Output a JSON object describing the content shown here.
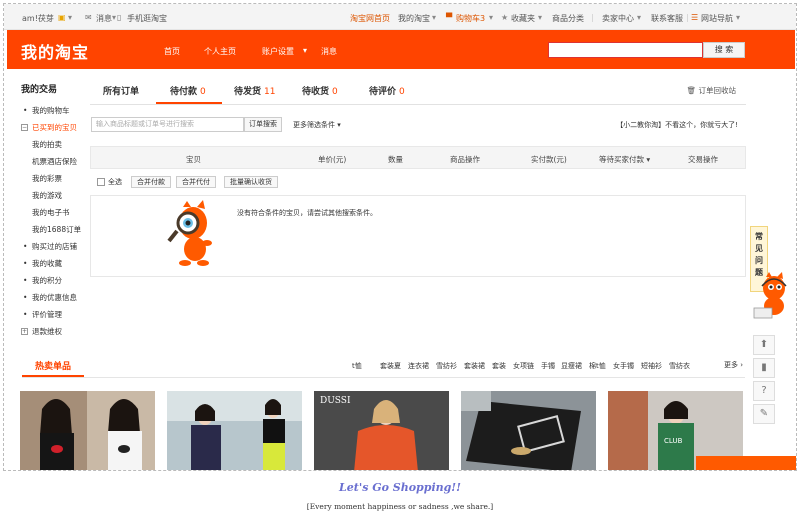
{
  "topbar": {
    "user": "am!茯芽",
    "messages": "消息",
    "mobile": "手机逛淘宝",
    "home": "淘宝网首页",
    "my_taobao": "我的淘宝",
    "cart": "购物车3",
    "favorites": "收藏夹",
    "categories": "商品分类",
    "seller": "卖家中心",
    "service": "联系客服",
    "site_nav": "网站导航"
  },
  "header": {
    "brand": "我的淘宝",
    "nav": [
      "首页",
      "个人主页",
      "账户设置",
      "消息"
    ],
    "search_button": "搜 索"
  },
  "sidebar": {
    "title": "我的交易",
    "items": [
      {
        "label": "我的购物车",
        "type": "bullet"
      },
      {
        "label": "已买到的宝贝",
        "type": "box-active"
      },
      {
        "label": "我的拍卖",
        "type": "sub"
      },
      {
        "label": "机票酒店保险",
        "type": "sub"
      },
      {
        "label": "我的彩票",
        "type": "sub"
      },
      {
        "label": "我的游戏",
        "type": "sub"
      },
      {
        "label": "我的电子书",
        "type": "sub"
      },
      {
        "label": "我的1688订单",
        "type": "sub"
      },
      {
        "label": "购买过的店铺",
        "type": "bullet"
      },
      {
        "label": "我的收藏",
        "type": "bullet"
      },
      {
        "label": "我的积分",
        "type": "bullet"
      },
      {
        "label": "我的优惠信息",
        "type": "bullet"
      },
      {
        "label": "评价管理",
        "type": "bullet"
      },
      {
        "label": "退款维权",
        "type": "box"
      }
    ]
  },
  "tabs": [
    {
      "label": "所有订单",
      "count": ""
    },
    {
      "label": "待付款",
      "count": "0"
    },
    {
      "label": "待发货",
      "count": "11"
    },
    {
      "label": "待收货",
      "count": "0"
    },
    {
      "label": "待评价",
      "count": "0"
    }
  ],
  "recycle_bin": "订单回收站",
  "filter": {
    "placeholder": "输入商品标题或订单号进行搜索",
    "search_button": "订单搜索",
    "more_filters": "更多筛选条件",
    "xiaoer": "【小二教你淘】不看这个，你就亏大了!"
  },
  "table_headers": [
    "宝贝",
    "单价(元)",
    "数量",
    "商品操作",
    "实付款(元)",
    "等待买家付款",
    "交易操作"
  ],
  "batch": {
    "select_all": "全选",
    "buttons": [
      "合并付款",
      "合并代付",
      "批量确认收货"
    ]
  },
  "empty_message": "没有符合条件的宝贝，请尝试其他搜索条件。",
  "faq": "常见问题",
  "hot": {
    "title": "热卖单品",
    "keywords": [
      "t恤",
      "套装夏",
      "连衣裙",
      "雪纺衫",
      "套装裙",
      "套装",
      "女项链",
      "手镯",
      "显瘦裙",
      "棉t恤",
      "女手镯",
      "短袖衫",
      "雪纺衣"
    ],
    "more": "更多"
  },
  "footer": {
    "slogan": "Let's Go Shopping!!",
    "tagline": "[Every moment happiness or sadness ,we share.]",
    "product3_brand": "DUSSI",
    "product5_text": "CLUB"
  },
  "colors": {
    "brand_orange": "#ff4400",
    "accent": "#f40",
    "slogan": "#6a6fd0"
  }
}
